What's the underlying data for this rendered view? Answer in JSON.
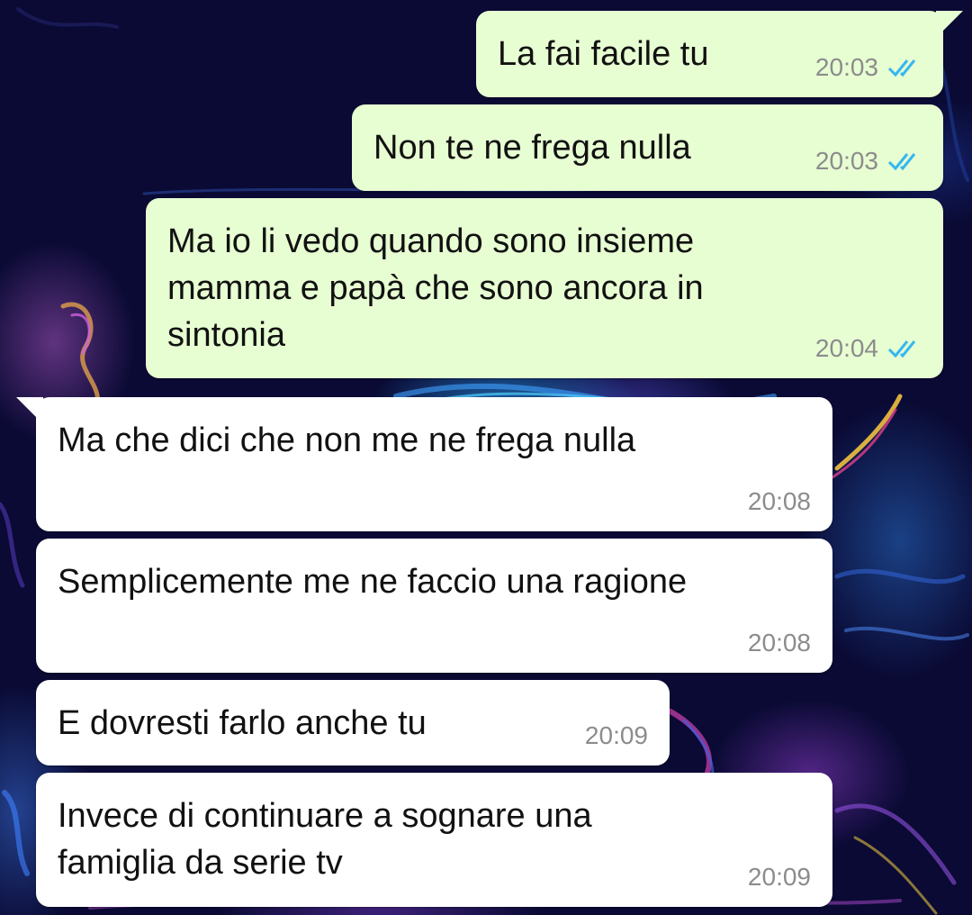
{
  "chat": {
    "messages": [
      {
        "direction": "outgoing",
        "text": "La fai facile tu",
        "time": "20:03",
        "status_icon": "double-check-read-icon"
      },
      {
        "direction": "outgoing",
        "text": "Non te ne frega nulla",
        "time": "20:03",
        "status_icon": "double-check-read-icon"
      },
      {
        "direction": "outgoing",
        "lines": [
          "Ma io li vedo quando sono insieme",
          "mamma e papà che sono ancora in",
          "sintonia"
        ],
        "time": "20:04",
        "status_icon": "double-check-read-icon"
      },
      {
        "direction": "incoming",
        "text": "Ma che dici che non me ne frega nulla",
        "time": "20:08"
      },
      {
        "direction": "incoming",
        "text": "Semplicemente me ne faccio una ragione",
        "time": "20:08"
      },
      {
        "direction": "incoming",
        "text": "E dovresti farlo anche tu",
        "time": "20:09"
      },
      {
        "direction": "incoming",
        "lines": [
          "Invece di continuare a sognare una",
          "famiglia da serie tv"
        ],
        "time": "20:09"
      }
    ]
  },
  "colors": {
    "outgoing_bubble": "#e7fdd2",
    "incoming_bubble": "#ffffff",
    "read_tick": "#34b7f1",
    "timestamp": "#8c8c8c",
    "wallpaper_base": "#0a0a34"
  }
}
